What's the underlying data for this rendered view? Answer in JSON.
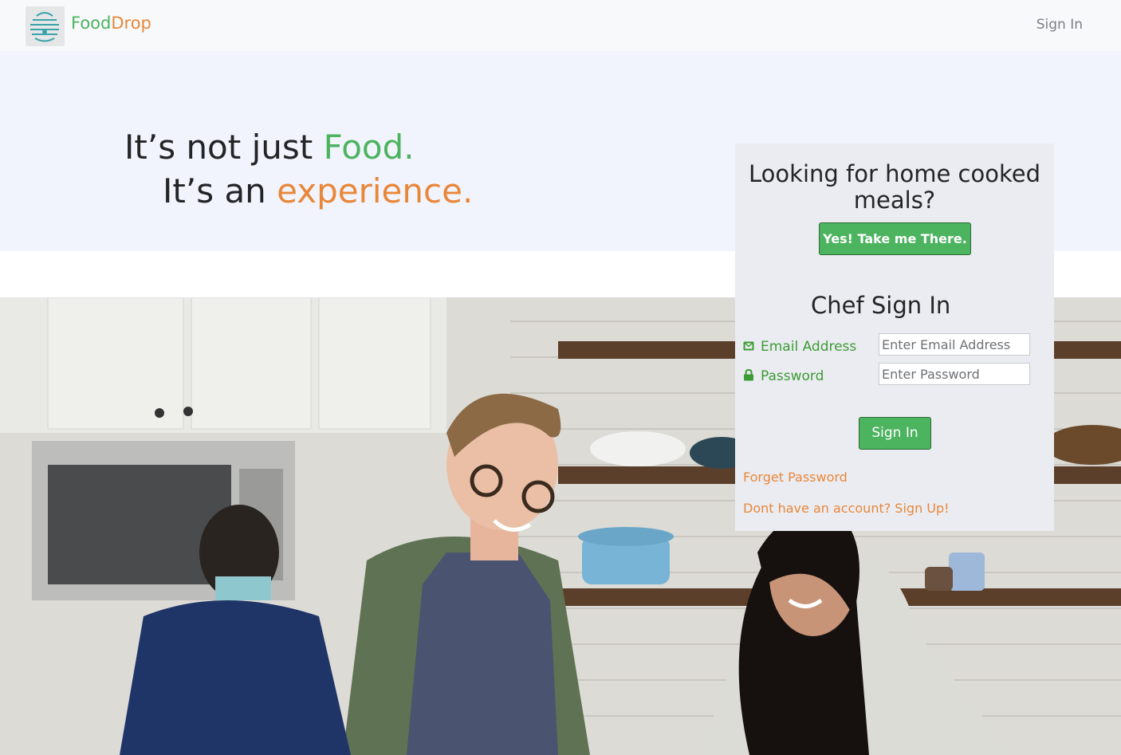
{
  "navbar": {
    "brand_food": "Food",
    "brand_drop": "Drop",
    "signin_label": "Sign In"
  },
  "hero": {
    "line1_prefix": "It’s not just ",
    "line1_highlight": "Food.",
    "line2_prefix": "It’s an ",
    "line2_highlight": "experience."
  },
  "card": {
    "question": "Looking for home cooked meals?",
    "yes_button": "Yes! Take me There.",
    "chef_title": "Chef Sign In",
    "email_label": "Email Address",
    "email_placeholder": "Enter Email Address",
    "password_label": "Password",
    "password_placeholder": "Enter Password",
    "signin_button": "Sign In",
    "forget_link": "Forget Password",
    "signup_link": "Dont have an account? Sign Up!"
  },
  "colors": {
    "brand_green": "#4cb35f",
    "brand_orange": "#e8873a",
    "hero_bg": "#f1f4fc",
    "card_bg": "#ebecf1",
    "label_green": "#3d9b35"
  },
  "icons": {
    "logo": "beehive-logo-icon",
    "email": "envelope-icon",
    "password": "lock-icon"
  }
}
